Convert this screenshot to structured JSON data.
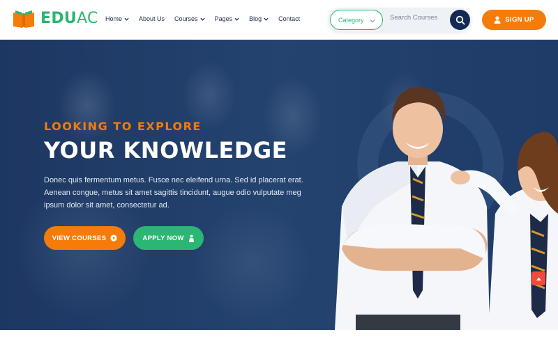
{
  "brand": {
    "part1": "EDU",
    "part2": "AC",
    "green": "#2bb673",
    "orange": "#f57c0a",
    "navy": "#142a54"
  },
  "nav": {
    "items": [
      {
        "label": "Home",
        "dropdown": true
      },
      {
        "label": "About Us",
        "dropdown": false
      },
      {
        "label": "Courses",
        "dropdown": true
      },
      {
        "label": "Pages",
        "dropdown": true
      },
      {
        "label": "Blog",
        "dropdown": true
      },
      {
        "label": "Contact",
        "dropdown": false
      }
    ]
  },
  "search": {
    "category_label": "Category",
    "placeholder": "Search Courses"
  },
  "signup": {
    "label": "SIGN UP"
  },
  "hero": {
    "kicker": "LOOKING TO EXPLORE",
    "headline": "YOUR KNOWLEDGE",
    "description": "Donec quis fermentum metus. Fusce nec eleifend urna. Sed id placerat erat. Aenean congue, metus sit amet sagittis tincidunt, augue odio vulputate meg ipsum dolor sit amet, consectetur ad.",
    "primary_button": "VIEW COURSES",
    "secondary_button": "APPLY NOW"
  },
  "icons": [
    "book-logo-icon",
    "chevron-down-icon",
    "search-icon",
    "user-icon",
    "play-circle-icon",
    "graduate-icon",
    "arrow-up-icon"
  ]
}
